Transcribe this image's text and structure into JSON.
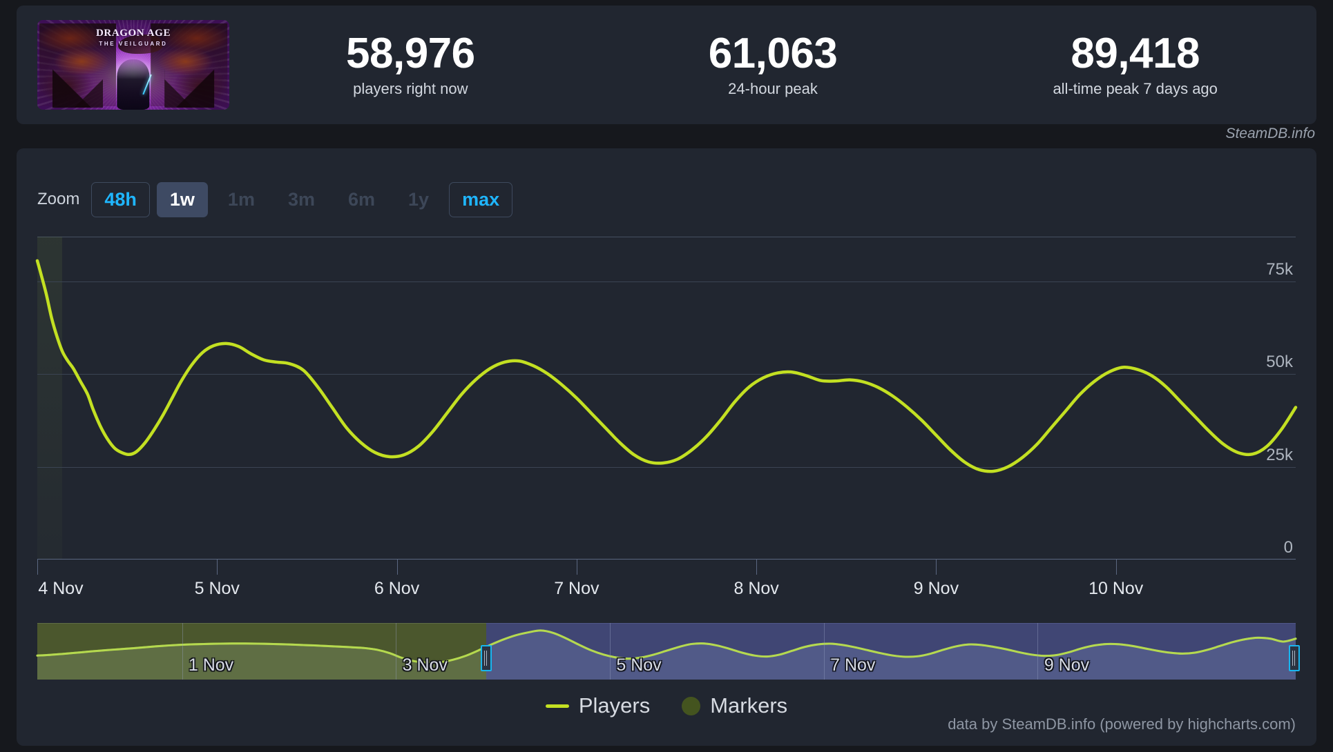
{
  "header": {
    "game": {
      "capsule_title_line1": "DRAGON AGE",
      "capsule_title_line2": "THE VEILGUARD"
    },
    "stats": [
      {
        "value": "58,976",
        "label": "players right now"
      },
      {
        "value": "61,063",
        "label": "24-hour peak"
      },
      {
        "value": "89,418",
        "label": "all-time peak 7 days ago"
      }
    ],
    "watermark": "SteamDB.info"
  },
  "chart_card": {
    "zoom": {
      "label": "Zoom",
      "buttons": [
        {
          "label": "48h",
          "state": "outlined"
        },
        {
          "label": "1w",
          "state": "selected"
        },
        {
          "label": "1m",
          "state": "muted"
        },
        {
          "label": "3m",
          "state": "muted"
        },
        {
          "label": "6m",
          "state": "muted"
        },
        {
          "label": "1y",
          "state": "muted"
        },
        {
          "label": "max",
          "state": "outlined"
        }
      ]
    },
    "legend": [
      {
        "label": "Players",
        "marker": "line",
        "color": "#c3e022"
      },
      {
        "label": "Markers",
        "marker": "dot",
        "color": "#44541f"
      }
    ],
    "credit": "data by SteamDB.info (powered by highcharts.com)"
  },
  "chart_data": {
    "type": "line",
    "title": "",
    "xlabel": "",
    "ylabel": "",
    "ylim": [
      0,
      87000
    ],
    "yticks": [
      0,
      25000,
      50000,
      75000
    ],
    "ytick_labels": [
      "0",
      "25k",
      "50k",
      "75k"
    ],
    "grid": true,
    "legend_position": "bottom",
    "xtick_labels": [
      "4 Nov",
      "5 Nov",
      "6 Nov",
      "7 Nov",
      "8 Nov",
      "9 Nov",
      "10 Nov"
    ],
    "series": [
      {
        "name": "Players",
        "color": "#c3e022",
        "x": [
          0.0,
          0.02,
          0.05,
          0.08,
          0.11,
          0.14,
          0.17,
          0.2,
          0.24,
          0.28,
          0.31,
          0.35,
          0.39,
          0.43,
          0.47,
          0.51,
          0.55,
          0.6,
          0.65,
          0.7,
          0.75,
          0.8,
          0.86,
          0.92,
          0.98,
          1.05,
          1.12,
          1.19,
          1.26,
          1.33,
          1.4,
          1.48,
          1.56,
          1.64,
          1.72,
          1.8,
          1.88,
          1.96,
          2.04,
          2.12,
          2.2,
          2.28,
          2.36,
          2.44,
          2.52,
          2.6,
          2.68,
          2.76,
          2.84,
          2.92,
          3.0,
          3.08,
          3.16,
          3.24,
          3.32,
          3.4,
          3.48,
          3.56,
          3.64,
          3.72,
          3.8,
          3.88,
          3.96,
          4.04,
          4.12,
          4.2,
          4.28,
          4.36,
          4.44,
          4.52,
          4.6,
          4.68,
          4.76,
          4.84,
          4.92,
          5.0,
          5.08,
          5.16,
          5.24,
          5.32,
          5.4,
          5.48,
          5.56,
          5.64,
          5.72,
          5.8,
          5.88,
          5.96,
          6.04,
          6.12,
          6.2,
          6.28,
          6.36,
          6.44,
          6.52,
          6.6,
          6.68,
          6.76,
          6.84,
          6.92,
          7.0
        ],
        "y": [
          80500,
          77000,
          71500,
          65000,
          60000,
          56000,
          53500,
          51500,
          48000,
          44500,
          40500,
          36000,
          32500,
          30000,
          28800,
          28300,
          29000,
          31500,
          35000,
          39000,
          43500,
          48000,
          52500,
          55800,
          57600,
          58200,
          57400,
          55400,
          53800,
          53200,
          52800,
          51000,
          46500,
          41000,
          35500,
          31500,
          28800,
          27700,
          28200,
          30500,
          34500,
          39500,
          44500,
          48500,
          51500,
          53200,
          53500,
          52200,
          50000,
          47000,
          43500,
          39500,
          35500,
          31500,
          28200,
          26300,
          26000,
          27000,
          29500,
          33000,
          37500,
          42500,
          46500,
          49000,
          50300,
          50500,
          49500,
          48200,
          48100,
          48400,
          47800,
          46300,
          44000,
          41000,
          37500,
          33500,
          29500,
          26200,
          24200,
          23800,
          25000,
          27500,
          31000,
          35500,
          40000,
          44500,
          48000,
          50500,
          51800,
          51200,
          49500,
          46500,
          42500,
          38500,
          34500,
          31000,
          28800,
          28400,
          30500,
          35000,
          41000
        ]
      }
    ],
    "navigator": {
      "full_range_labels": [
        "1 Nov",
        "3 Nov",
        "5 Nov",
        "7 Nov",
        "9 Nov"
      ],
      "selection_start_fraction": 0.357,
      "selection_end_fraction": 1.0,
      "y": [
        23500,
        24200,
        25200,
        26300,
        27500,
        28600,
        29600,
        30500,
        31500,
        32600,
        33600,
        34400,
        35000,
        35400,
        35700,
        35900,
        36000,
        35900,
        35700,
        35400,
        35000,
        34500,
        34000,
        33400,
        32800,
        32100,
        31300,
        29500,
        26000,
        21000,
        17500,
        16000,
        16500,
        19000,
        23000,
        28500,
        34500,
        40000,
        44500,
        47500,
        49500,
        47000,
        41500,
        35000,
        29000,
        24500,
        21500,
        20200,
        21500,
        24500,
        28500,
        32500,
        35500,
        36000,
        34000,
        30500,
        26500,
        23500,
        22500,
        24500,
        28500,
        32500,
        35000,
        35800,
        34500,
        32000,
        29000,
        26000,
        23500,
        22200,
        22800,
        25500,
        29500,
        33000,
        35000,
        34500,
        32500,
        30000,
        27000,
        24500,
        23200,
        24000,
        27000,
        31000,
        34000,
        35500,
        35200,
        33500,
        31000,
        28500,
        26500,
        25500,
        26500,
        29500,
        33500,
        37500,
        40500,
        42000,
        41000,
        38000,
        41000
      ]
    }
  }
}
